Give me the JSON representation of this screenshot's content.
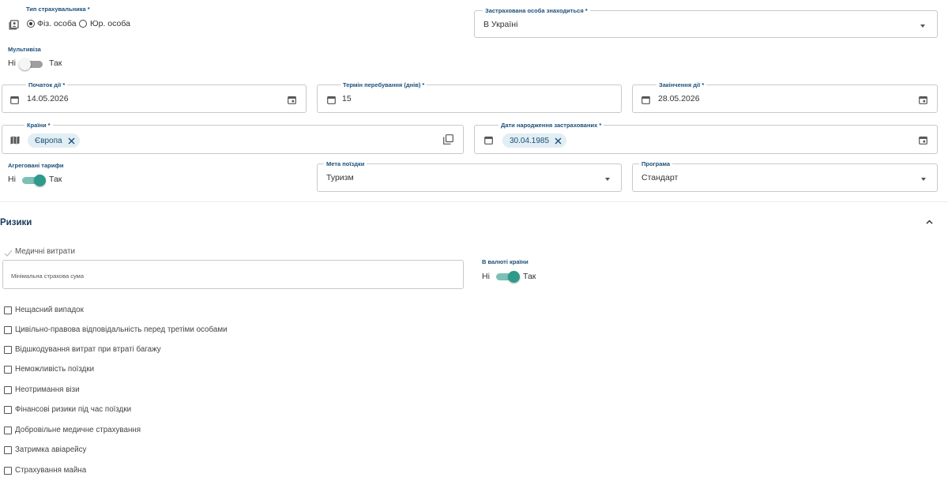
{
  "insurer_type": {
    "label": "Тип страхувальника *",
    "options": [
      "Фіз. особа",
      "Юр. особа"
    ],
    "selected": "Фіз. особа"
  },
  "insured_location": {
    "label": "Застрахована особа знаходиться *",
    "value": "В Україні"
  },
  "multivisa": {
    "label": "Мультивіза",
    "off_label": "Ні",
    "on_label": "Так",
    "enabled": false
  },
  "start_date": {
    "label": "Початок дії *",
    "value": "14.05.2026"
  },
  "stay_term": {
    "label": "Термін перебування (днів) *",
    "value": "15"
  },
  "end_date": {
    "label": "Закінчення дії *",
    "value": "28.05.2026"
  },
  "countries": {
    "label": "Країни *",
    "chips": [
      "Європа"
    ]
  },
  "birth_dates": {
    "label": "Дати народження застрахованих *",
    "chips": [
      "30.04.1985"
    ]
  },
  "aggregated_tariffs": {
    "label": "Агреговані тарифи",
    "off_label": "Ні",
    "on_label": "Так",
    "enabled": true
  },
  "trip_purpose": {
    "label": "Мета поїздки",
    "value": "Туризм"
  },
  "program": {
    "label": "Програма",
    "value": "Стандарт"
  },
  "risks": {
    "title": "Ризики",
    "medical": {
      "label": "Медичні витрати",
      "min_sum_placeholder": "Мінімальна страхова сума",
      "currency_label": "В валюті країни",
      "currency_off": "Ні",
      "currency_on": "Так",
      "currency_enabled": true
    },
    "items": [
      "Нещасний випадок",
      "Цивільно-правова відповідальність перед третіми особами",
      "Відшкодування витрат при втраті багажу",
      "Неможливість поїздки",
      "Неотримання візи",
      "Фінансові ризики під час поїздки",
      "Добровільне медичне страхування",
      "Затримка авіарейсу",
      "Страхування майна"
    ]
  },
  "icons": {
    "insurer_type": "contact-card-icon",
    "calendar": "calendar-icon",
    "calendar_pick": "calendar-today-icon",
    "map": "map-icon",
    "copy": "copy-icon",
    "chip_remove": "close-icon",
    "dropdown": "caret-down-icon",
    "collapse": "chevron-up-icon",
    "check": "check-icon"
  },
  "colors": {
    "label_blue": "#1b4f7a",
    "toggle_teal": "#2e9a8a",
    "chip_bg": "#e1eef3"
  }
}
